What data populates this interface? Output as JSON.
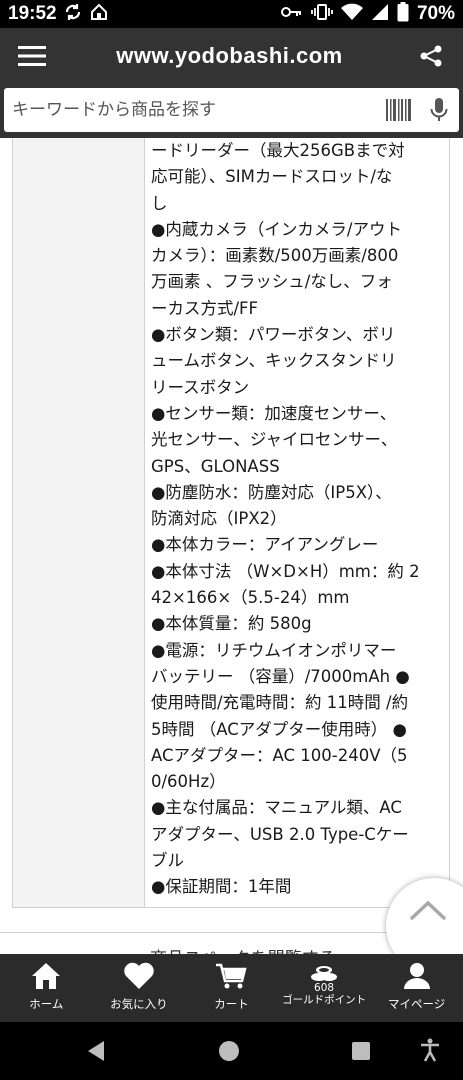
{
  "status_bar": {
    "time": "19:52",
    "battery": "70%"
  },
  "header": {
    "site_title": "www.yodobashi.com"
  },
  "search": {
    "placeholder": "キーワードから商品を探す"
  },
  "spec_lines": [
    "ードリーダー（最大256GBまで対",
    "応可能）、SIMカードスロット/な",
    "し",
    "●内蔵カメラ（インカメラ/アウト",
    "カメラ）：画素数/500万画素/800",
    "万画素 、フラッシュ/なし、フォ",
    "ーカス方式/FF",
    "●ボタン類：パワーボタン、ボリ",
    "ュームボタン、キックスタンドリ",
    "リースボタン",
    "●センサー類：加速度センサー、",
    "光センサー、ジャイロセンサー、",
    "GPS、GLONASS",
    "●防塵防水：防塵対応（IP5X）、",
    "防滴対応（IPX2）",
    "●本体カラー：アイアングレー",
    "●本体寸法 （W×D×H）mm：約 2",
    "42×166×（5.5-24）mm",
    "●本体質量：約 580g",
    "●電源：リチウムイオンポリマー",
    "バッテリー （容量）/7000mAh ●",
    "使用時間/充電時間：約 11時間 /約",
    "5時間 （ACアダプター使用時） ●",
    "ACアダプター：AC 100-240V（5",
    "0/60Hz）",
    "●主な付属品：マニュアル類、AC",
    "アダプター、USB 2.0 Type-Cケー",
    "ブル",
    "●保証期間：1年間"
  ],
  "next_section_heading": "商品スペックを閲覧する",
  "bottom_nav": {
    "home": "ホーム",
    "favorites": "お気に入り",
    "cart": "カート",
    "points_count": "608",
    "points_label": "ゴールドポイント",
    "mypage": "マイページ"
  }
}
